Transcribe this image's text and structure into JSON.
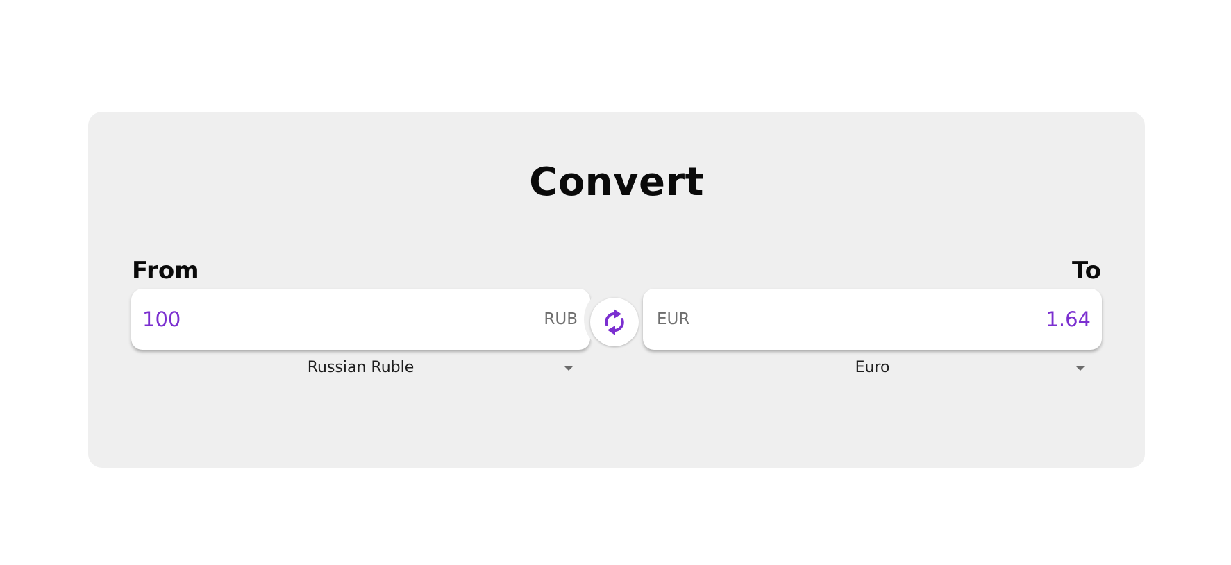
{
  "converter": {
    "title": "Convert",
    "from": {
      "label": "From",
      "amount": "100",
      "code": "RUB",
      "currency_name": "Russian Ruble"
    },
    "to": {
      "label": "To",
      "amount": "1.64",
      "code": "EUR",
      "currency_name": "Euro"
    },
    "swap_icon": "swap-arrows-icon",
    "colors": {
      "accent": "#7b2fd0",
      "card_background": "#efefef",
      "page_background": "#ffffff",
      "code_text": "#6e6e6e"
    }
  }
}
